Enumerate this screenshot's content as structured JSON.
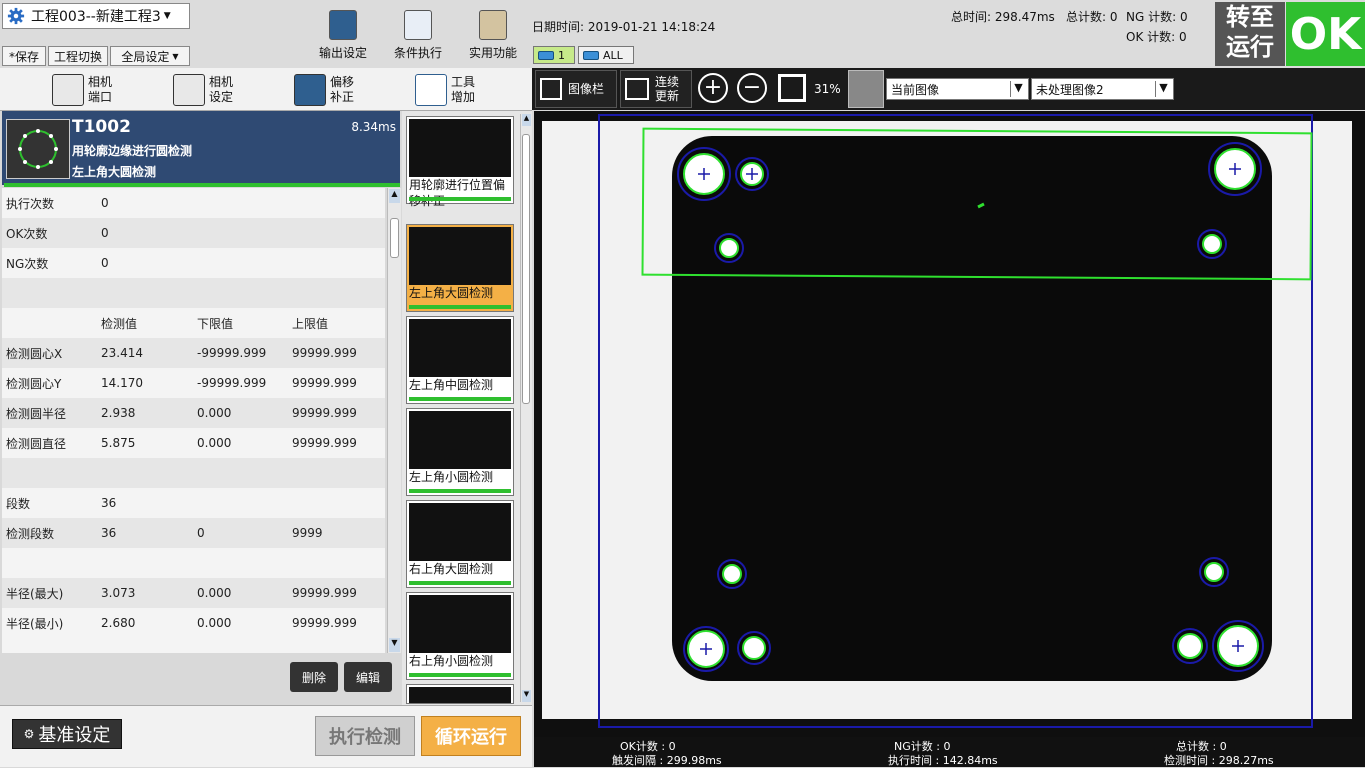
{
  "header": {
    "project": "工程003--新建工程3",
    "save": "*保存",
    "switch_proj": "工程切换",
    "global": "全局设定",
    "tools": [
      {
        "label": "输出设定"
      },
      {
        "label": "条件执行"
      },
      {
        "label": "实用功能"
      }
    ],
    "datetime": "日期时间: 2019-01-21 14:18:24",
    "total_time": "总时间:  298.47ms",
    "total_count": "总计数: 0",
    "ng_count": "NG 计数: 0",
    "ok_count": "OK 计数: 0",
    "port1": "1",
    "port_all": "ALL",
    "switch_run": [
      "转至",
      "运行"
    ],
    "ok": "OK"
  },
  "subtools": [
    {
      "a": "相机",
      "b": "端口"
    },
    {
      "a": "相机",
      "b": "设定"
    },
    {
      "a": "偏移",
      "b": "补正"
    },
    {
      "a": "工具",
      "b": "增加"
    }
  ],
  "tool": {
    "id": "T1002",
    "time": "8.34ms",
    "name": "用轮廓边缘进行圆检测",
    "sub": "左上角大圆检测"
  },
  "table": {
    "headers": [
      "检测值",
      "下限值",
      "上限值"
    ],
    "rows": [
      [
        "执行次数",
        "0",
        "",
        ""
      ],
      [
        "OK次数",
        "0",
        "",
        ""
      ],
      [
        "NG次数",
        "0",
        "",
        ""
      ],
      [
        "",
        "",
        "",
        ""
      ],
      [
        "",
        "检测值",
        "下限值",
        "上限值"
      ],
      [
        "检测圆心X",
        "23.414",
        "-99999.999",
        "99999.999"
      ],
      [
        "检测圆心Y",
        "14.170",
        "-99999.999",
        "99999.999"
      ],
      [
        "检测圆半径",
        "2.938",
        "0.000",
        "99999.999"
      ],
      [
        "检测圆直径",
        "5.875",
        "0.000",
        "99999.999"
      ],
      [
        "",
        "",
        "",
        ""
      ],
      [
        "段数",
        "36",
        "",
        ""
      ],
      [
        "检测段数",
        "36",
        "0",
        "9999"
      ],
      [
        "",
        "",
        "",
        ""
      ],
      [
        "半径(最大)",
        "3.073",
        "0.000",
        "99999.999"
      ],
      [
        "半径(最小)",
        "2.680",
        "0.000",
        "99999.999"
      ]
    ]
  },
  "actions": {
    "delete": "删除",
    "edit": "编辑",
    "baseline": "基准设定",
    "exec": "执行检测",
    "loop": "循环运行"
  },
  "thumbs": [
    {
      "label": "用轮廓进行位置偏移补正"
    },
    {
      "label": "左上角大圆检测"
    },
    {
      "label": "左上角中圆检测"
    },
    {
      "label": "左上角小圆检测"
    },
    {
      "label": "右上角大圆检测"
    },
    {
      "label": "右上角小圆检测"
    }
  ],
  "imgtools": {
    "imgbar": "图像栏",
    "cont_a": "连续",
    "cont_b": "更新",
    "zoom": "31%",
    "cur": "当前图像",
    "raw": "未处理图像2"
  },
  "status": {
    "ok": "OK计数 : 0",
    "ng": "NG计数 : 0",
    "total": "总计数 : 0",
    "trigger": "触发间隔 : 299.98ms",
    "exec": "执行时间 : 142.84ms",
    "detect": "检测时间 : 298.27ms"
  },
  "colors": {
    "ok_green": "#2fbf2f",
    "selected": "#f4b046",
    "header_blue": "#2f4a73"
  }
}
